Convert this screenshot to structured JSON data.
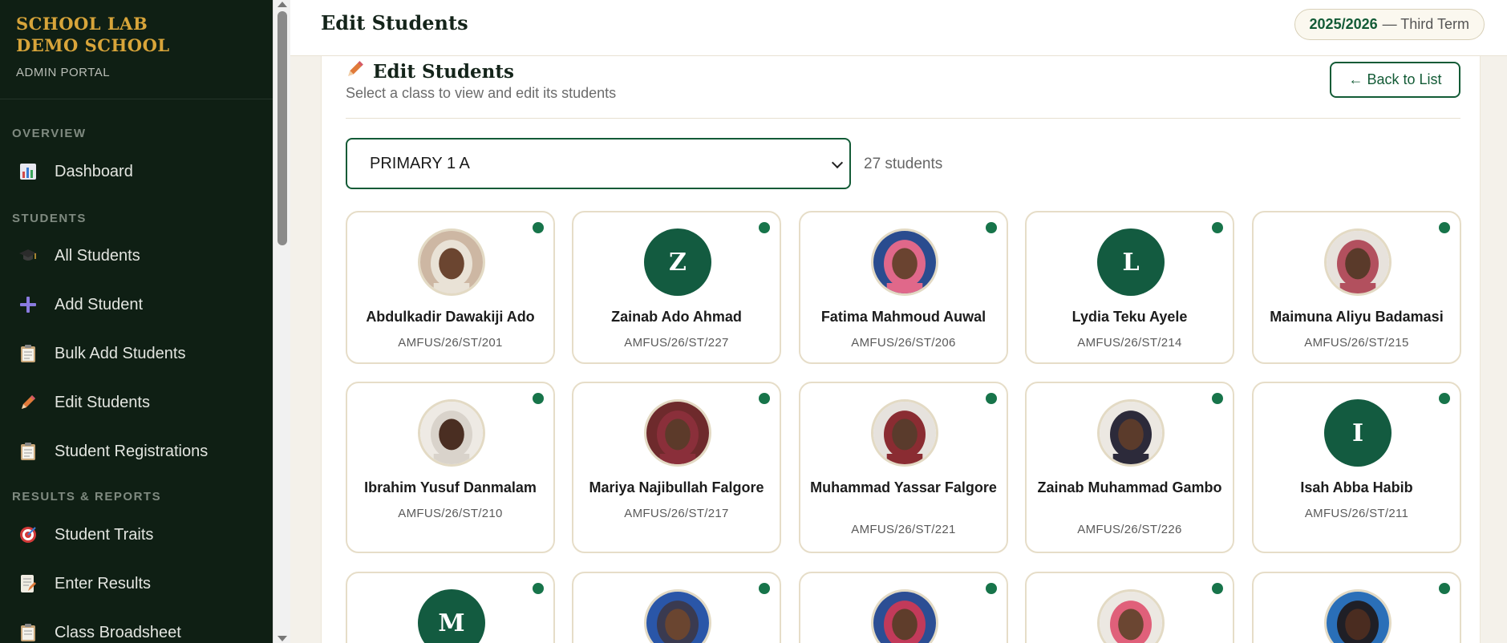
{
  "brand": {
    "line1": "SCHOOL LAB",
    "line2": "DEMO SCHOOL",
    "sub": "ADMIN PORTAL"
  },
  "nav": {
    "sections": [
      "OVERVIEW",
      "STUDENTS",
      "RESULTS & REPORTS"
    ],
    "items": [
      {
        "label": "Dashboard",
        "icon": "bar-chart-icon"
      },
      {
        "label": "All Students",
        "icon": "graduation-cap-icon"
      },
      {
        "label": "Add Student",
        "icon": "plus-icon"
      },
      {
        "label": "Bulk Add Students",
        "icon": "clipboard-icon"
      },
      {
        "label": "Edit Students",
        "icon": "pencil-icon"
      },
      {
        "label": "Student Registrations",
        "icon": "clipboard-icon"
      },
      {
        "label": "Student Traits",
        "icon": "target-icon"
      },
      {
        "label": "Enter Results",
        "icon": "memo-icon"
      },
      {
        "label": "Class Broadsheet",
        "icon": "clipboard-icon"
      }
    ]
  },
  "header": {
    "title": "Edit Students",
    "term_year": "2025/2026",
    "term_rest": "— Third Term"
  },
  "panel": {
    "title": "Edit Students",
    "subtitle": "Select a class to view and edit its students",
    "back_label": "← Back to List",
    "selected_class": "PRIMARY 1 A",
    "count_label": "27 students"
  },
  "students": [
    {
      "name": "Abdulkadir Dawakiji Ado",
      "id": "AMFUS/26/ST/201",
      "initial": "",
      "photo": {
        "bg": "#cdb7a3",
        "face": "#6b4530",
        "wrap": "#e9e2d6"
      }
    },
    {
      "name": "Zainab Ado Ahmad",
      "id": "AMFUS/26/ST/227",
      "initial": "Z"
    },
    {
      "name": "Fatima Mahmoud Auwal",
      "id": "AMFUS/26/ST/206",
      "initial": "",
      "photo": {
        "bg": "#2a4c8f",
        "face": "#6a4330",
        "wrap": "#e0688a"
      }
    },
    {
      "name": "Lydia Teku Ayele",
      "id": "AMFUS/26/ST/214",
      "initial": "L"
    },
    {
      "name": "Maimuna Aliyu Badamasi",
      "id": "AMFUS/26/ST/215",
      "initial": "",
      "photo": {
        "bg": "#e7e2dc",
        "face": "#5a3a2a",
        "wrap": "#b2505e"
      }
    },
    {
      "name": "Ibrahim Yusuf Danmalam",
      "id": "AMFUS/26/ST/210",
      "initial": "",
      "photo": {
        "bg": "#eeeae4",
        "face": "#4a2e22",
        "wrap": "#d9d3cb"
      }
    },
    {
      "name": "Mariya Najibullah Falgore",
      "id": "AMFUS/26/ST/217",
      "initial": "",
      "photo": {
        "bg": "#6e2a2c",
        "face": "#5c3a2a",
        "wrap": "#8a2f3a"
      }
    },
    {
      "name": "Muhammad Yassar Falgore",
      "id": "AMFUS/26/ST/221",
      "initial": "",
      "photo": {
        "bg": "#e6e2dd",
        "face": "#5a3b2c",
        "wrap": "#8a2c32"
      }
    },
    {
      "name": "Zainab Muhammad Gambo",
      "id": "AMFUS/26/ST/226",
      "initial": "",
      "photo": {
        "bg": "#ece8e2",
        "face": "#5b3b2b",
        "wrap": "#2c2a3a"
      }
    },
    {
      "name": "Isah Abba Habib",
      "id": "AMFUS/26/ST/211",
      "initial": "I"
    },
    {
      "name": "",
      "id": "",
      "initial": "M"
    },
    {
      "name": "",
      "id": "",
      "initial": "",
      "photo": {
        "bg": "#2a56a8",
        "face": "#6a4530",
        "wrap": "#3a3a50"
      }
    },
    {
      "name": "",
      "id": "",
      "initial": "",
      "photo": {
        "bg": "#2c4e94",
        "face": "#5f3d2b",
        "wrap": "#c23a5a"
      }
    },
    {
      "name": "",
      "id": "",
      "initial": "",
      "photo": {
        "bg": "#ece8e2",
        "face": "#6b4632",
        "wrap": "#e0607a"
      }
    },
    {
      "name": "",
      "id": "",
      "initial": "",
      "photo": {
        "bg": "#2a6fb8",
        "face": "#4a2c20",
        "wrap": "#1f1f26"
      }
    }
  ]
}
